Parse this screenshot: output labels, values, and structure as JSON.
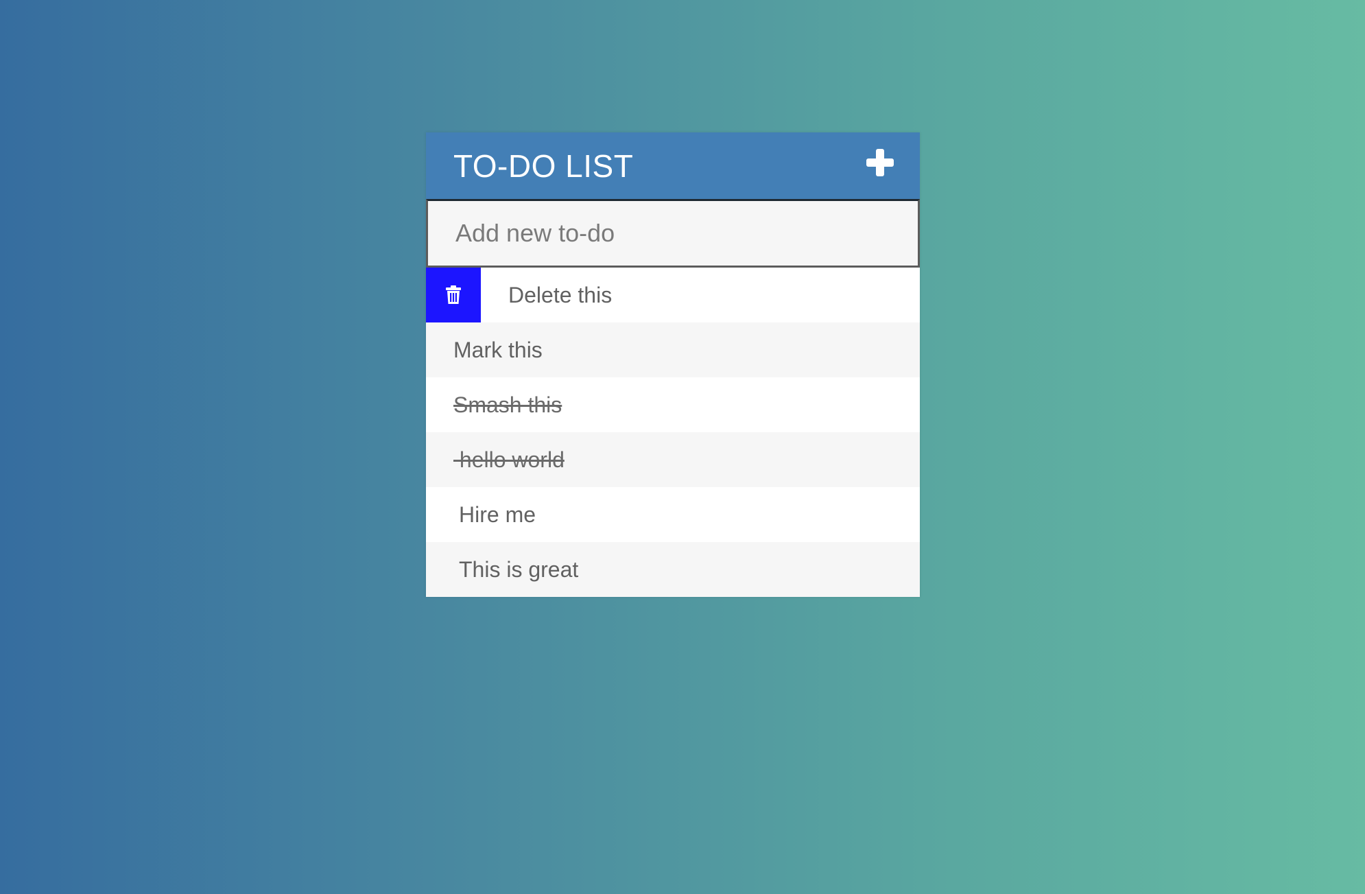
{
  "app": {
    "title": "TO-DO LIST",
    "add_icon": "plus-icon",
    "accent_color": "#437fb6",
    "delete_color": "#1c15ff"
  },
  "new_todo": {
    "placeholder": "Add new to-do",
    "value": ""
  },
  "todos": [
    {
      "text": "Delete this",
      "completed": false,
      "delete_visible": true,
      "delete_icon": "trash-icon"
    },
    {
      "text": "Mark this",
      "completed": false
    },
    {
      "text": "Smash this",
      "completed": true
    },
    {
      "text": " hello world",
      "completed": true
    },
    {
      "text": "Hire me",
      "completed": false
    },
    {
      "text": "This is great",
      "completed": false
    }
  ]
}
